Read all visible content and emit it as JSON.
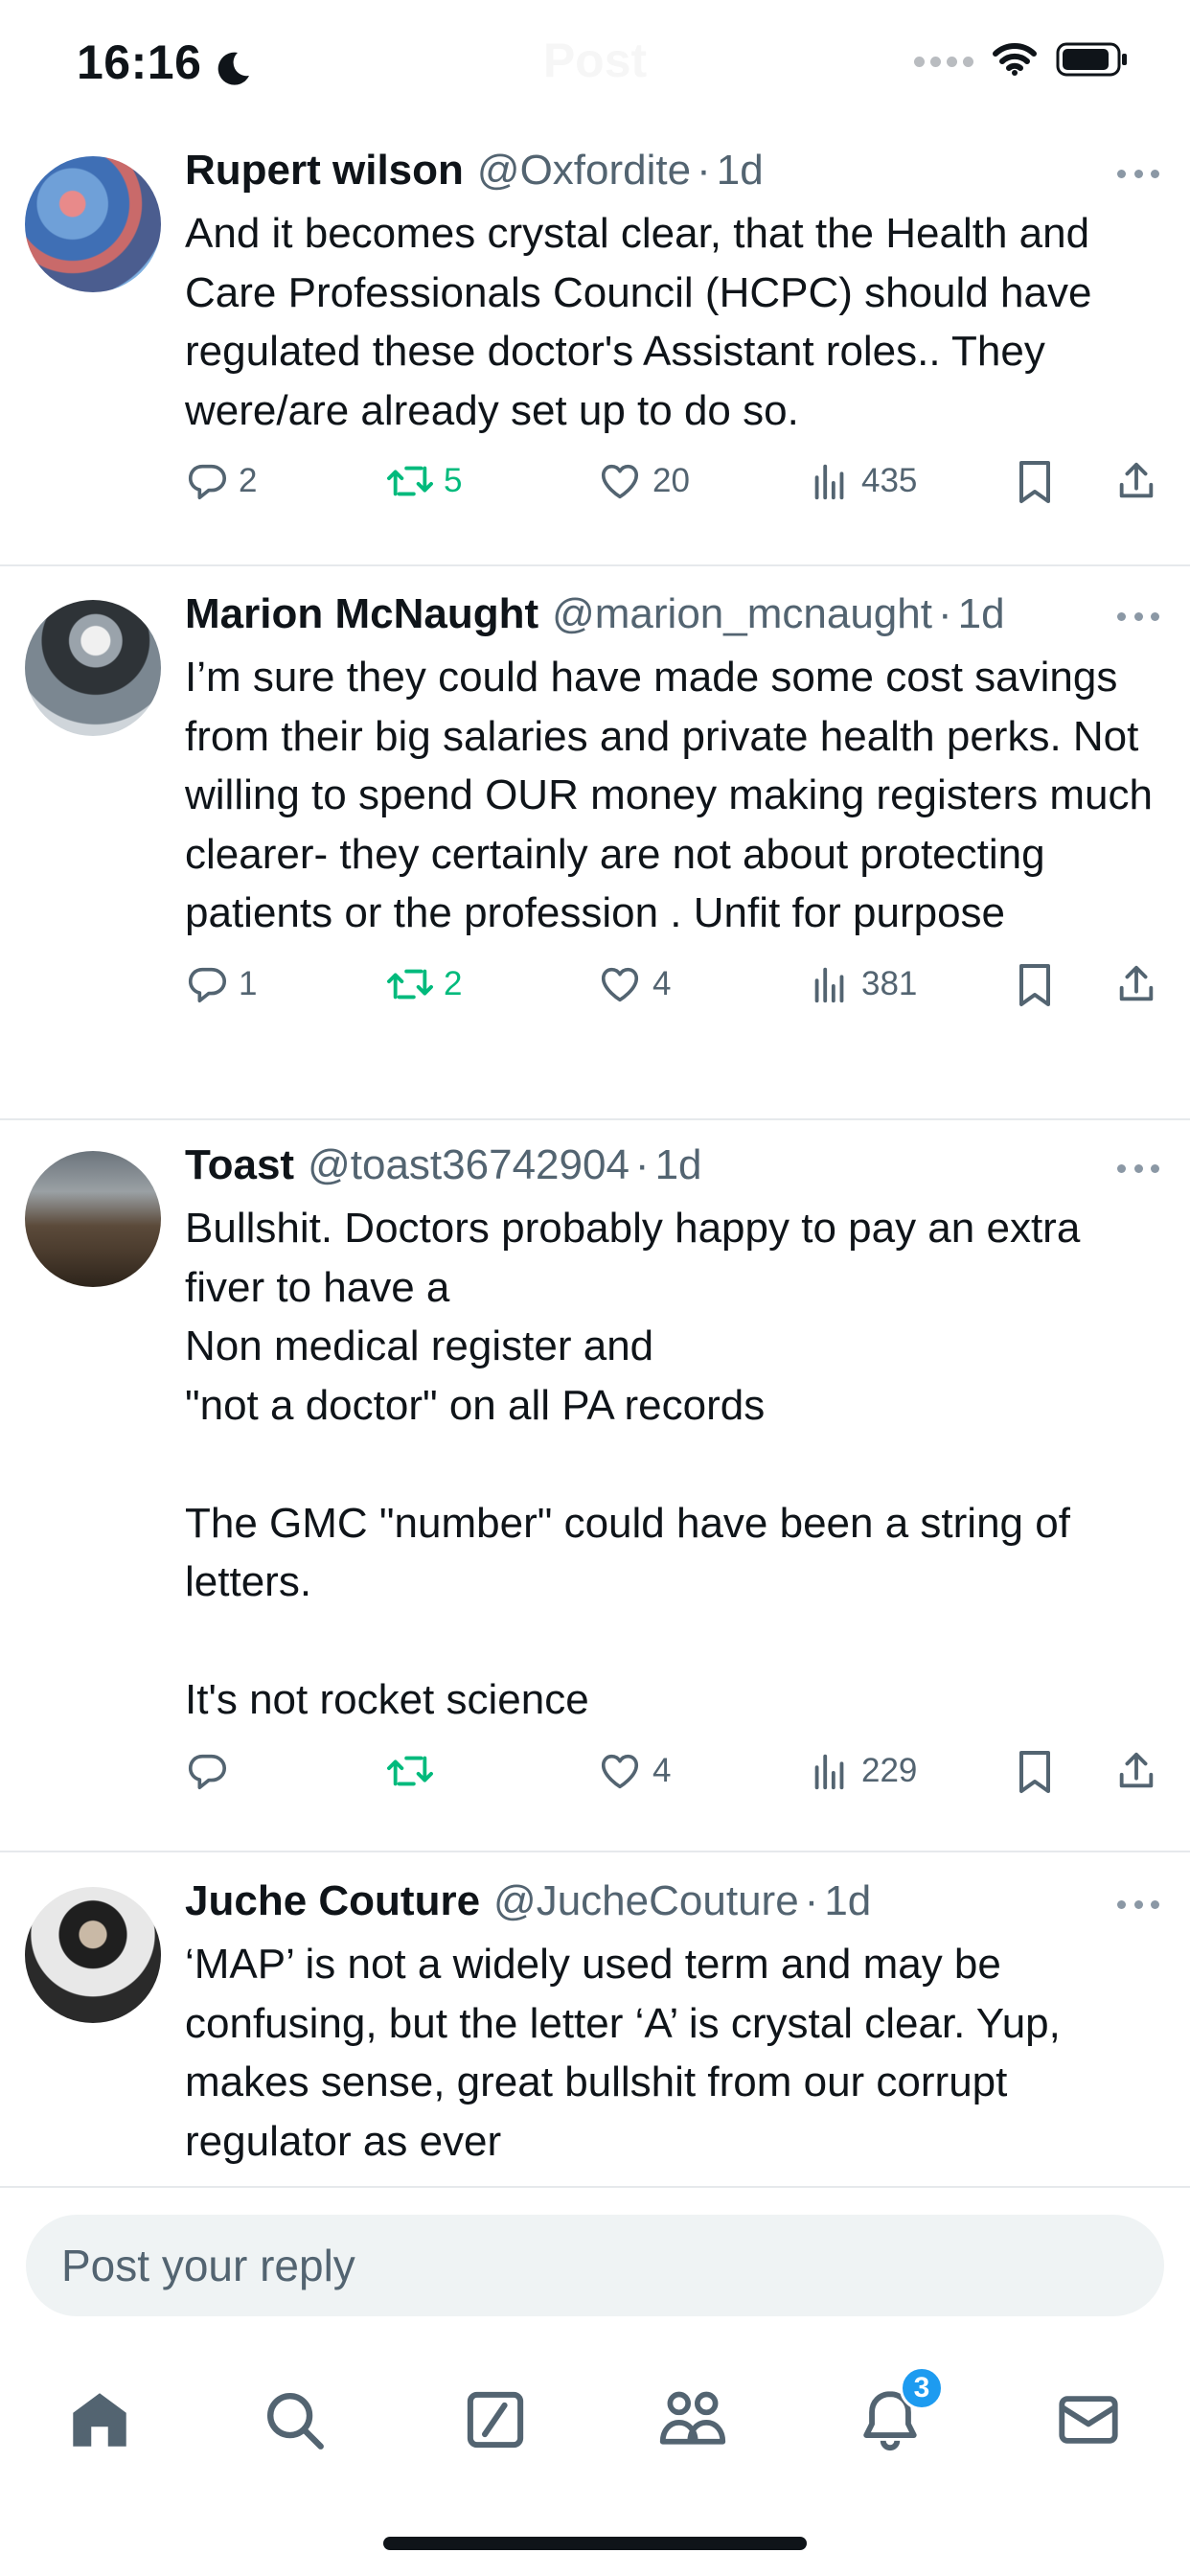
{
  "status_bar": {
    "time": "16:16",
    "ghost_title": "Post"
  },
  "tweets": [
    {
      "name": "Rupert wilson",
      "handle": "@Oxfordite",
      "age": "1d",
      "text": "And it becomes crystal clear, that the Health and Care Professionals Council (HCPC) should have regulated these doctor's Assistant roles.. They were/are already set up to do so.",
      "replies": "2",
      "reposts": "5",
      "likes": "20",
      "views": "435"
    },
    {
      "name": "Marion McNaught",
      "handle": "@marion_mcnaught",
      "age": "1d",
      "text": "I’m sure they could have made some cost savings from their big salaries and private health perks. Not willing to spend OUR money making registers much clearer- they certainly are not about protecting patients or the profession . Unfit for purpose",
      "replies": "1",
      "reposts": "2",
      "likes": "4",
      "views": "381"
    },
    {
      "name": "Toast",
      "handle": "@toast36742904",
      "age": "1d",
      "text": "Bullshit. Doctors probably happy to pay an extra fiver to have a\nNon medical register and\n\"not a doctor\" on all PA records\n\nThe GMC \"number\" could have been a string of letters.\n\nIt's not rocket science",
      "replies": "",
      "reposts": "",
      "likes": "4",
      "views": "229"
    },
    {
      "name": "Juche Couture",
      "handle": "@JucheCouture",
      "age": "1d",
      "text": "‘MAP’ is not a widely used term and may be confusing, but the letter ‘A’ is crystal clear. Yup, makes sense, great bullshit from our corrupt regulator as ever"
    }
  ],
  "reply": {
    "placeholder": "Post your reply"
  },
  "tab_bar": {
    "items": [
      "home-icon",
      "search-icon",
      "grok-icon",
      "communities-icon",
      "notifications-icon",
      "messages-icon"
    ],
    "notifications_badge": "3"
  },
  "colors": {
    "accent": "#1d9bf0",
    "repost_green": "#00ba7c",
    "secondary_text": "#536471",
    "reply_field": "#eff3f4"
  }
}
